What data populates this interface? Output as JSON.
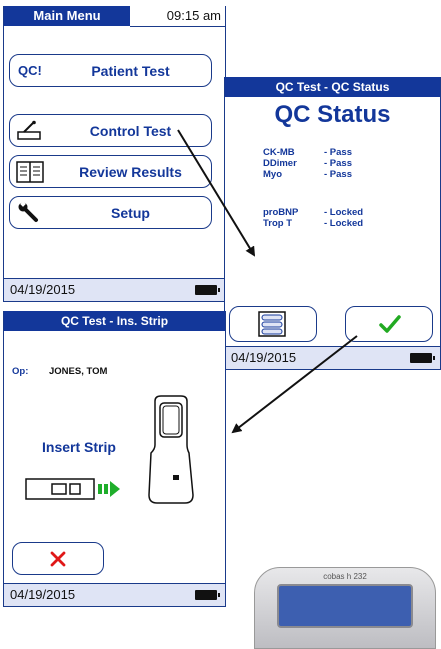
{
  "main_menu": {
    "title": "Main Menu",
    "time": "09:15 am",
    "buttons": [
      {
        "icon_text": "QC!",
        "label": "Patient Test"
      },
      {
        "icon": "strip-icon",
        "label": "Control Test"
      },
      {
        "icon": "book-icon",
        "label": "Review Results"
      },
      {
        "icon": "wrench-icon",
        "label": "Setup"
      }
    ],
    "date": "04/19/2015"
  },
  "qc_status": {
    "header": "QC Test - QC Status",
    "title": "QC Status",
    "results": [
      {
        "name": "CK-MB",
        "status": "- Pass"
      },
      {
        "name": "DDimer",
        "status": "- Pass"
      },
      {
        "name": "Myo",
        "status": "- Pass"
      },
      {
        "name": "proBNP",
        "status": "- Locked"
      },
      {
        "name": "Trop T",
        "status": "- Locked"
      }
    ],
    "list_button_icon": "list-icon",
    "confirm_button_icon": "checkmark-icon",
    "date": "04/19/2015"
  },
  "insert_strip": {
    "header": "QC Test - Ins. Strip",
    "op_label": "Op:",
    "op_name": "JONES, TOM",
    "instruction": "Insert Strip",
    "cancel_button_icon": "x-icon",
    "date": "04/19/2015"
  },
  "device": {
    "brand": "cobas h 232"
  },
  "colors": {
    "primary": "#13379a",
    "status_bar": "#dfe4f5",
    "confirm_green": "#22aa22",
    "cancel_red": "#e01818",
    "arrow_green": "#1fae2b"
  }
}
